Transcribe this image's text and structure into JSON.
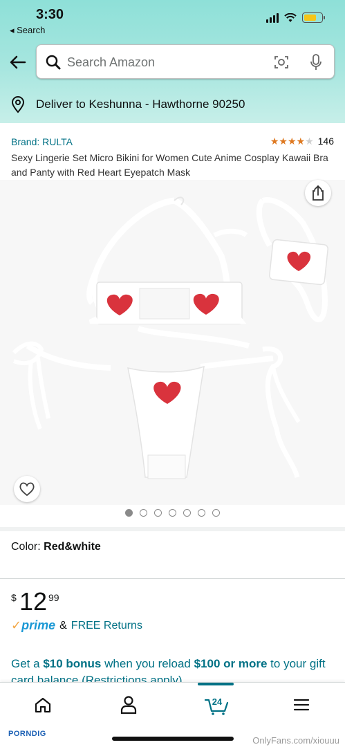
{
  "status_bar": {
    "time": "3:30",
    "back_app": "◂ Search",
    "battery_level": 0.7
  },
  "search": {
    "placeholder": "Search Amazon"
  },
  "delivery": {
    "text": "Deliver to Keshunna - Hawthorne 90250"
  },
  "product": {
    "brand": "Brand: RULTA",
    "rating_stars": 4,
    "rating_count": "146",
    "title": "Sexy Lingerie Set Micro Bikini for Women Cute Anime Cosplay Kawaii Bra and Panty with Red Heart Eyepatch Mask",
    "image_count": 7,
    "active_image": 1
  },
  "color": {
    "label": "Color:",
    "value": "Red&white"
  },
  "price": {
    "currency": "$",
    "whole": "12",
    "fraction": "99"
  },
  "shipping": {
    "prime": "prime",
    "amp": "&",
    "returns": "FREE Returns"
  },
  "promo": {
    "pre": "Get a ",
    "bonus": "$10 bonus",
    "mid": " when you reload ",
    "amount": "$100 or more",
    "post": " to your gift card balance (Restrictions apply)"
  },
  "bottom_nav": {
    "items": [
      "home-icon",
      "account-icon",
      "cart-icon",
      "menu-icon"
    ],
    "cart_count": "24"
  },
  "watermark": {
    "left": "PORNDIG",
    "right": "OnlyFans.com/xiouuu"
  },
  "colors": {
    "teal_link": "#007185",
    "star": "#de7921",
    "heart": "#e0303a",
    "prime_blue": "#1a98d5"
  }
}
